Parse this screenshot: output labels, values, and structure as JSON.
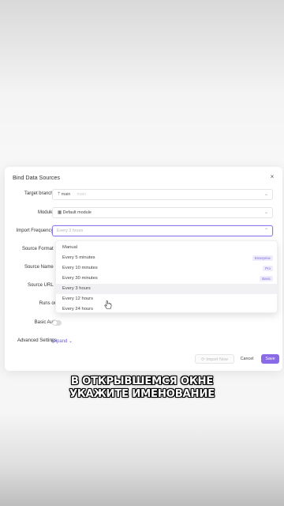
{
  "dialog": {
    "title": "Bind Data Sources",
    "close_glyph": "×"
  },
  "form": {
    "target_branch": {
      "label": "Target branch",
      "value": "main",
      "secondary": "main",
      "icon": "branch-icon"
    },
    "module": {
      "label": "Module",
      "value": "Default module",
      "icon": "module-icon"
    },
    "import_frequency": {
      "label": "Import Frequency",
      "placeholder": "Every 3 hours"
    },
    "source_format": {
      "label": "Source Format"
    },
    "source_name": {
      "label": "Source Name"
    },
    "source_url": {
      "label": "Source URL"
    },
    "runs_on": {
      "label": "Runs on"
    },
    "basic_auth": {
      "label": "Basic Auth",
      "enabled": false
    },
    "advanced_settings": {
      "label": "Advanced Settings",
      "expand_label": "Expand"
    }
  },
  "required_mark": "*",
  "dropdown": {
    "options": [
      {
        "label": "Manual",
        "badge": ""
      },
      {
        "label": "Every 5 minutes",
        "badge": "Enterprise"
      },
      {
        "label": "Every 10 minutes",
        "badge": "Pro"
      },
      {
        "label": "Every 30 minutes",
        "badge": "Basic"
      },
      {
        "label": "Every 3 hours",
        "badge": ""
      },
      {
        "label": "Every 12 hours",
        "badge": ""
      },
      {
        "label": "Every 24 hours",
        "badge": ""
      }
    ],
    "hovered_index": 4
  },
  "buttons": {
    "import_now": "Import Now",
    "cancel": "Cancel",
    "save": "Save"
  },
  "caption": {
    "line1": "В ОТКРЫВШЕМСЯ ОКНЕ",
    "line2": "УКАЖИТЕ ИМЕНОВАНИЕ"
  },
  "colors": {
    "accent": "#8a6ae6",
    "link": "#6a5de0"
  }
}
